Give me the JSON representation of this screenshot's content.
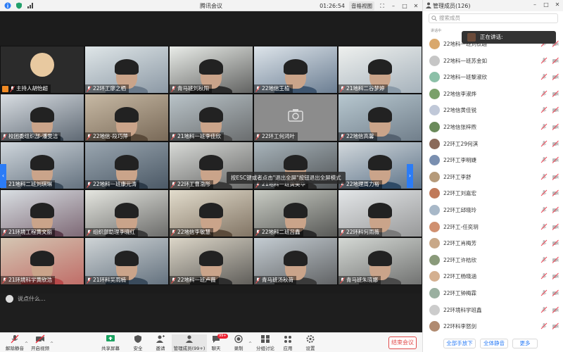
{
  "titlebar": {
    "title": "腾讯会议",
    "timer": "01:26:54",
    "view_label": "音格视图"
  },
  "tiles": [
    {
      "name": "主持人胡怡超",
      "host": true
    },
    {
      "name": "22环工廖之栖"
    },
    {
      "name": "青马班刘秋阳"
    },
    {
      "name": "22地信王植"
    },
    {
      "name": "21地科二谷梦婷"
    },
    {
      "name": "校团委组织部-潘雯洁"
    },
    {
      "name": "22地信-段巧萍"
    },
    {
      "name": "21地科一班李佳欣"
    },
    {
      "name": "22环工何鸿叶"
    },
    {
      "name": "22地信高馨"
    },
    {
      "name": "21地科二班刘琪琳"
    },
    {
      "name": "22地科一班康元涛"
    },
    {
      "name": "22环工曹渤彤"
    },
    {
      "name": "21地科一班黄美华"
    },
    {
      "name": "22地理周力裕"
    },
    {
      "name": "21环境工程黄文丽"
    },
    {
      "name": "组织部助理李晓红"
    },
    {
      "name": "22地信李敏慧"
    },
    {
      "name": "22地科二班吕鑫"
    },
    {
      "name": "22环科何雨薇"
    },
    {
      "name": "21环境科学黄欣浩"
    },
    {
      "name": "21环科吴雨楠"
    },
    {
      "name": "22地科一班卢薇"
    },
    {
      "name": "青马班汤秋荷"
    },
    {
      "name": "青马班朱晓娜"
    }
  ],
  "toast": "按ESC键或者点击\"退出全屏\"按钮退出全屏模式",
  "chat_placeholder": "说点什么...",
  "toolbar": {
    "mute": "解除静音",
    "video": "开启视频",
    "share": "共享屏幕",
    "security": "安全",
    "invite": "邀请",
    "members": "管理成员(99+)",
    "chat": "聊天",
    "chat_badge": "99+",
    "record": "录制",
    "breakout": "分组讨论",
    "apps": "应用",
    "settings": "设置",
    "end": "结束会议"
  },
  "panel": {
    "title": "管理成员(126)",
    "search_placeholder": "搜索成员",
    "speaking_label": "正在讲话:",
    "sub_label": "讲话中",
    "members": [
      "22地科一班刘钦越",
      "22地科一班苏金如",
      "22地科一班黎淑欣",
      "22地信李淑烨",
      "22地信黄佳锐",
      "22地信张梓煦",
      "22环工29何淇",
      "22环工李明婕",
      "22环工李舒",
      "22环工刘嘉宏",
      "22环工邱晓玲",
      "22环工-任奕玥",
      "22环工肖梅芳",
      "22环工许桔欣",
      "22环工杨晓涵",
      "22环工钟梅霖",
      "22环境科学班鑫",
      "22环科李怒剑"
    ],
    "footer": {
      "mute_all_hands": "全部手放下",
      "mute_all": "全体静音",
      "more": "更多"
    }
  }
}
